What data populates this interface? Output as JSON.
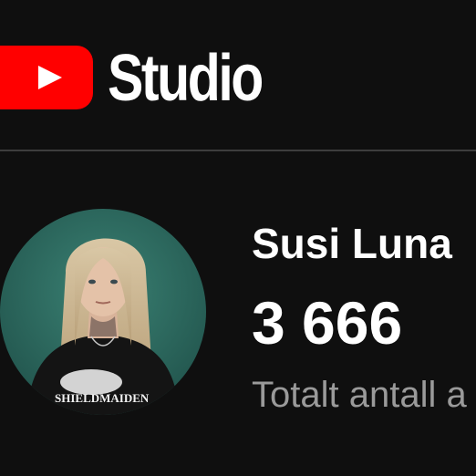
{
  "header": {
    "brand_text": "Studio",
    "brand_color": "#ff0000",
    "logo_icon": "play-icon"
  },
  "channel": {
    "name": "Susi Luna",
    "subscriber_count": "3 666",
    "caption": "Totalt antall a",
    "avatar_shirt_text": "SHIELDMAIDEN"
  },
  "colors": {
    "background": "#0f0f0f",
    "divider": "#3d3d3d",
    "primary_text": "#ffffff",
    "secondary_text": "#9a9a9a",
    "avatar_backdrop": "#2e6e63"
  }
}
